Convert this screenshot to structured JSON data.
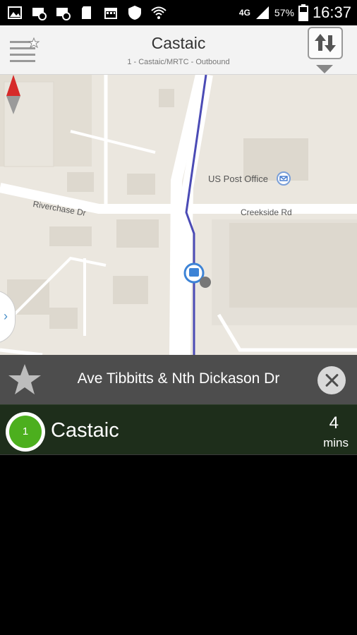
{
  "status_bar": {
    "network": "4G",
    "battery": "57%",
    "time": "16:37",
    "icons": [
      "image-icon",
      "message-icon",
      "message-icon",
      "sd-card-icon",
      "calendar-icon",
      "shield-icon",
      "wifi-icon",
      "signal-icon",
      "battery-icon"
    ]
  },
  "header": {
    "title": "Castaic",
    "subtitle": "1 - Castaic/MRTC - Outbound",
    "menu_icon": "favorites-menu-icon",
    "swap_icon": "swap-direction-icon"
  },
  "map": {
    "labels": {
      "post_office": "US Post Office",
      "creekside": "Creekside Rd",
      "riverchase": "Riverchase Dr"
    },
    "route_color": "#4b4bb5",
    "icons": [
      "compass-icon",
      "bus-stop-icon",
      "post-office-icon",
      "expand-panel-icon"
    ]
  },
  "stop": {
    "name": "Ave Tibbitts & Nth Dickason Dr",
    "favorite_icon": "star-icon",
    "close_icon": "close-icon"
  },
  "arrivals": [
    {
      "route": "1",
      "destination": "Castaic",
      "eta_value": "4",
      "eta_unit": "mins",
      "color": "#4caf1e"
    }
  ]
}
